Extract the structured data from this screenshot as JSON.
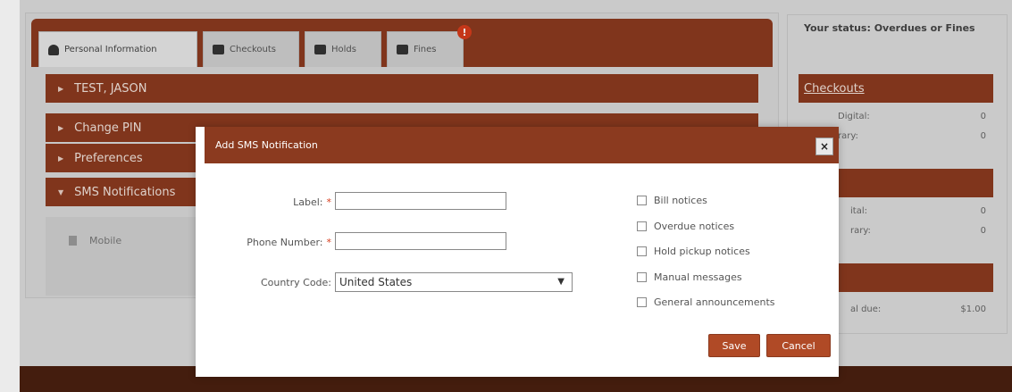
{
  "tabs": [
    {
      "label": "Personal Information",
      "icon": "person-icon"
    },
    {
      "label": "Checkouts",
      "icon": "checkbox-icon"
    },
    {
      "label": "Holds",
      "icon": "book-icon"
    },
    {
      "label": "Fines",
      "icon": "money-icon",
      "badge": "!"
    }
  ],
  "accordion": [
    {
      "label": "TEST, JASON"
    },
    {
      "label": "Change PIN"
    },
    {
      "label": "Preferences"
    },
    {
      "label": "SMS Notifications",
      "expanded": true
    }
  ],
  "sms_list": {
    "item": "Mobile"
  },
  "status": {
    "title": "Your status: Overdues or Fines",
    "checkouts_header": "Checkouts",
    "rows": [
      {
        "label": "Digital:",
        "value": "0"
      },
      {
        "label": "rary:",
        "value": "0"
      },
      {
        "label": "ital:",
        "value": "0"
      },
      {
        "label": "rary:",
        "value": "0"
      }
    ],
    "total_label": "al due:",
    "total_value": "$1.00"
  },
  "modal": {
    "title": "Add SMS Notification",
    "close": "×",
    "fields": {
      "label": "Label:",
      "phone": "Phone Number:",
      "country": "Country Code:",
      "required_mark": "*"
    },
    "country_value": "United States",
    "checkboxes": [
      "Bill notices",
      "Overdue notices",
      "Hold pickup notices",
      "Manual messages",
      "General announcements"
    ],
    "save_label": "Save",
    "cancel_label": "Cancel"
  },
  "colors": {
    "brand": "#8b3a1f",
    "button": "#b04a26",
    "required": "#d63c1c",
    "footer": "#4a2010"
  }
}
